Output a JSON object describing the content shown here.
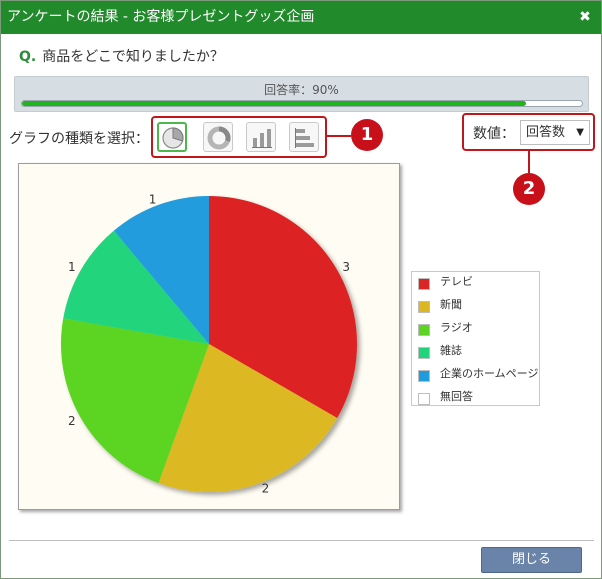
{
  "window": {
    "title": "アンケートの結果 - お客様プレゼントグッズ企画",
    "close_symbol": "✖"
  },
  "question": {
    "prefix": "Q.",
    "text": "商品をどこで知りましたか？"
  },
  "response": {
    "label": "回答率：90%",
    "rate_percent": 90
  },
  "chart_type": {
    "label": "グラフの種類を選択：",
    "options": [
      "pie-chart-icon",
      "donut-chart-icon",
      "bar-chart-icon",
      "horizontal-bar-chart-icon"
    ],
    "selected": "pie"
  },
  "value_mode": {
    "label": "数値：",
    "selected": "回答数",
    "arrow": "▼"
  },
  "callouts": {
    "one": "1",
    "two": "2"
  },
  "chart_data": {
    "type": "pie",
    "categories": [
      "テレビ",
      "新聞",
      "ラジオ",
      "雑誌",
      "企業のホームページ",
      "無回答"
    ],
    "values": [
      3,
      2,
      2,
      1,
      1,
      0
    ],
    "colors": [
      "#dc2424",
      "#dcb820",
      "#5cd424",
      "#20d47c",
      "#209cdc",
      "#ffffff"
    ],
    "legend_position": "right"
  },
  "footer": {
    "close_label": "閉じる"
  },
  "colors": {
    "titlebar": "#218a2b",
    "progress": "#22b322",
    "callout": "#c8101a",
    "button": "#6a83a8"
  }
}
